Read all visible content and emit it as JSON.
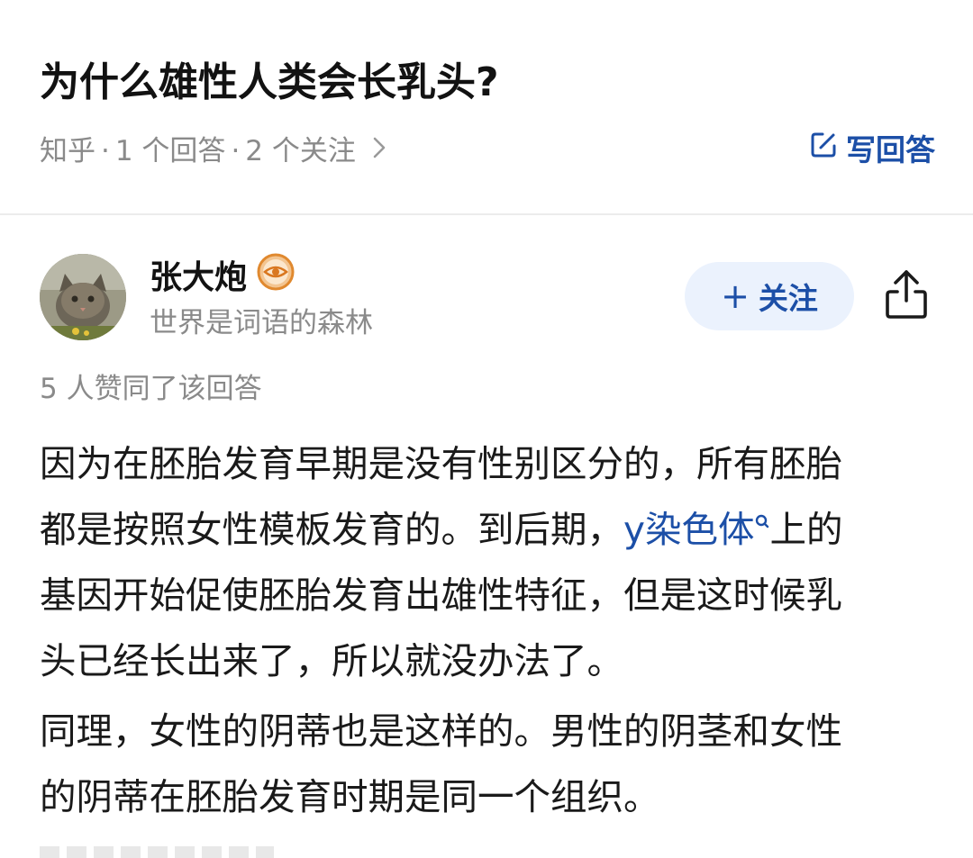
{
  "question": {
    "title": "为什么雄性人类会长乳头?",
    "meta_source": "知乎",
    "meta_answers": "1 个回答",
    "meta_follows": "2 个关注",
    "meta_separator": "·",
    "chevron_icon": "chevron-right-icon",
    "write_answer_label": "写回答",
    "write_answer_icon": "edit-icon"
  },
  "author": {
    "name": "张大炮",
    "badge_icon": "eye-badge-icon",
    "bio": "世界是词语的森林",
    "follow_label": "关注",
    "follow_prefix": "+",
    "share_icon": "share-icon"
  },
  "answer": {
    "votes_text": "5 人赞同了该回答",
    "p1_line1": "因为在胚胎发育早期是没有性别区分的，所有胚胎",
    "p1_line2_pre": "都是按照女性模板发育的。到后期，",
    "p1_line2_link": "y染色体",
    "p1_line2_post": "上的",
    "p1_line3": "基因开始促使胚胎发育出雄性特征，但是这时候乳",
    "p1_line4": "头已经长出来了，所以就没办法了。",
    "p2_line1": "同理，女性的阴蒂也是这样的。男性的阴茎和女性",
    "p2_line2": "的阴蒂在胚胎发育时期是同一个组织。"
  },
  "colors": {
    "accent": "#1c4fa7",
    "follow_bg": "#ebf2fd",
    "muted_text": "#8a8a8a",
    "badge": "#e0892f"
  }
}
